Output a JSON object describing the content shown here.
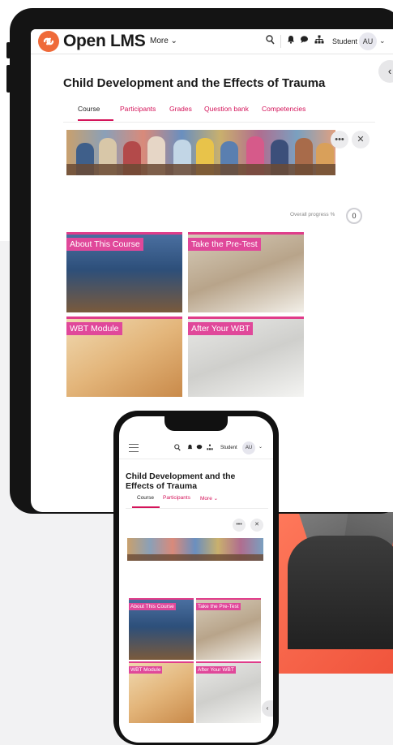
{
  "brand": {
    "name": "Open LMS",
    "accent": "#d4145a",
    "logo_color": "#ef6a39"
  },
  "header": {
    "more_label": "More ⌄",
    "search_icon": "search-icon",
    "user_name": "Student",
    "avatar_initials": "AU",
    "avatar_chevron": "⌄"
  },
  "course": {
    "title": "Child Development and the Effects of Trauma",
    "tabs": [
      {
        "label": "Course",
        "active": true
      },
      {
        "label": "Participants"
      },
      {
        "label": "Grades"
      },
      {
        "label": "Question bank"
      },
      {
        "label": "Competencies"
      }
    ],
    "progress_label": "Overall progress %",
    "progress_value": "0",
    "cards": [
      {
        "label": "About This Course"
      },
      {
        "label": "Take the Pre-Test"
      },
      {
        "label": "WBT Module"
      },
      {
        "label": "After Your WBT"
      }
    ]
  },
  "phone": {
    "title": "Child Development and the Effects of Trauma",
    "tabs": [
      {
        "label": "Course",
        "active": true
      },
      {
        "label": "Participants"
      },
      {
        "label": "More ⌄"
      }
    ],
    "user_name": "Student",
    "avatar_initials": "AU",
    "cards": [
      {
        "label": "About This Course"
      },
      {
        "label": "Take the Pre-Test"
      },
      {
        "label": "WBT Module"
      },
      {
        "label": "After Your WBT"
      }
    ]
  }
}
